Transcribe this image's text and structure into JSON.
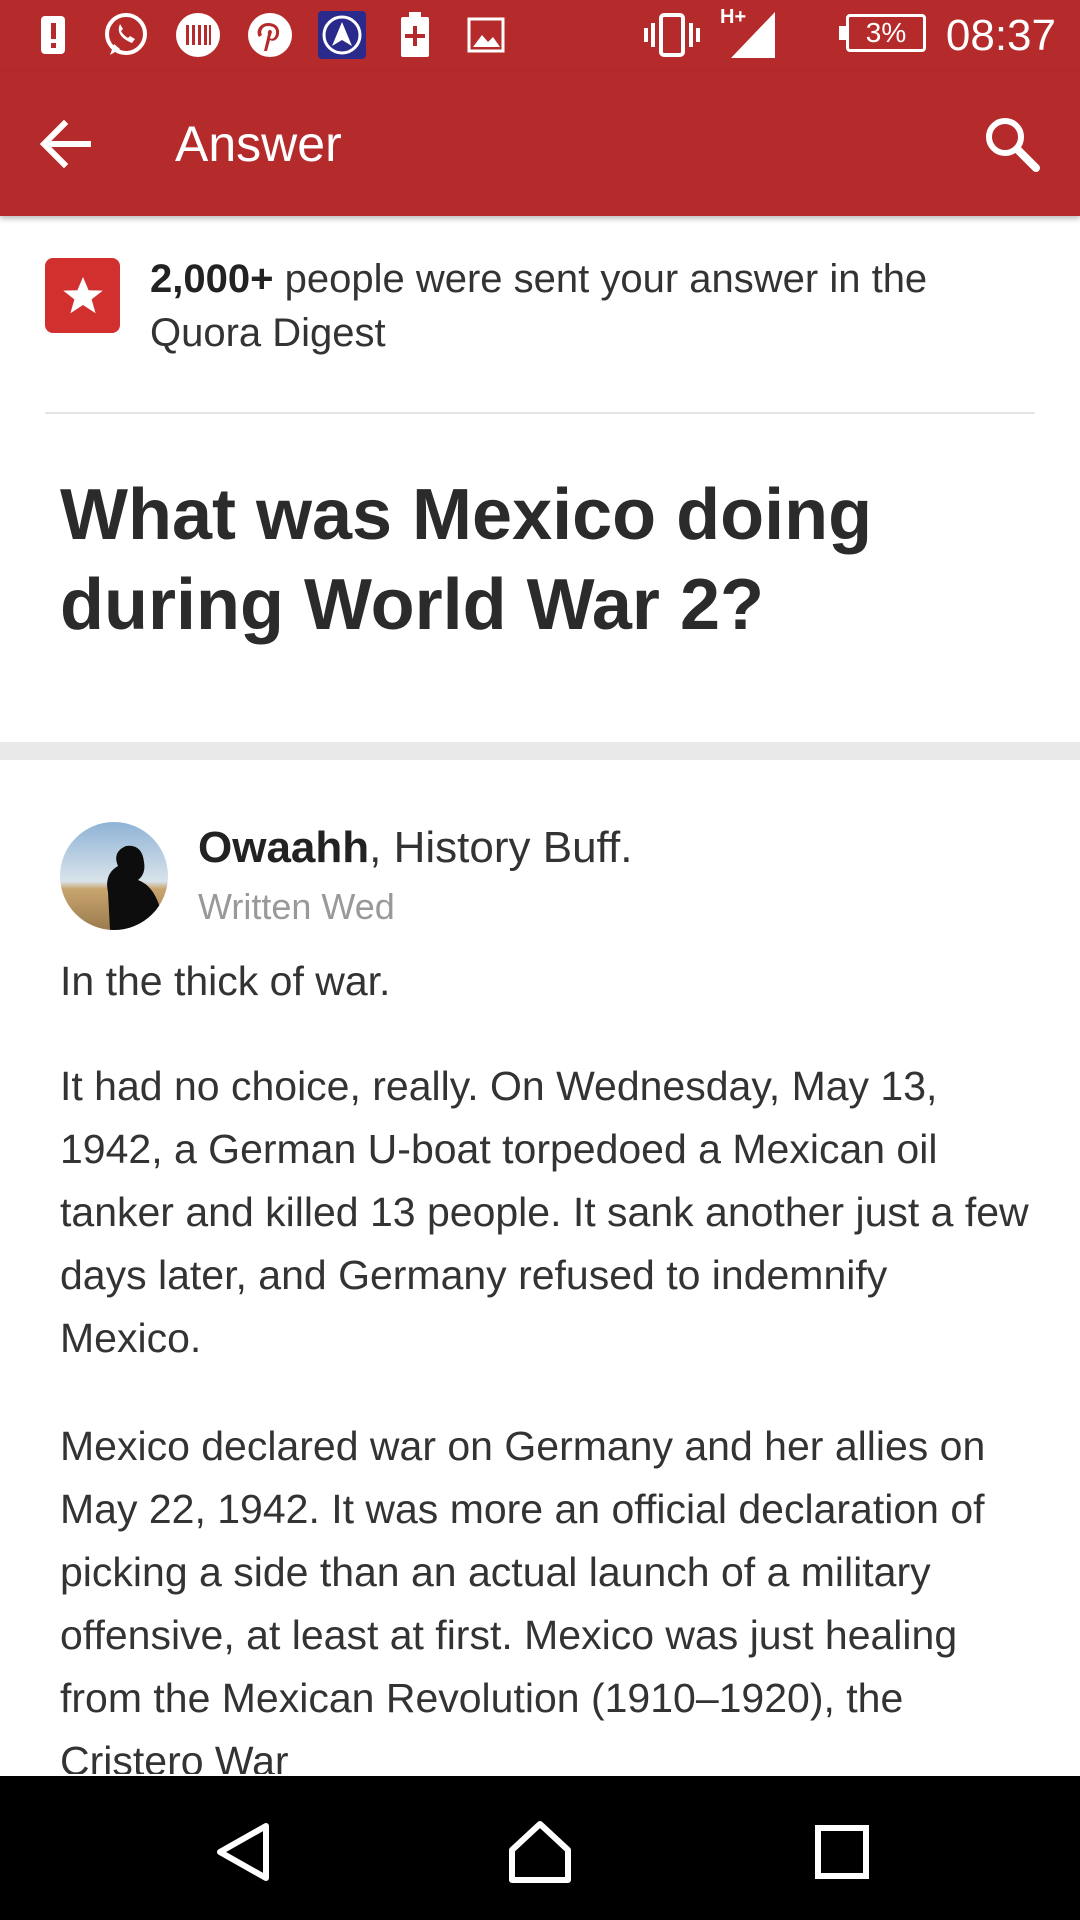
{
  "status_bar": {
    "time": "08:37",
    "battery": "3%",
    "network": "H+",
    "icons": [
      "alert-icon",
      "whatsapp-icon",
      "barcode-icon",
      "pinterest-icon",
      "app-a-icon",
      "battery-plus-icon",
      "image-icon",
      "vibrate-icon",
      "signal-icon"
    ]
  },
  "app_bar": {
    "title": "Answer",
    "back_icon": "arrow-left-icon",
    "search_icon": "search-icon"
  },
  "digest": {
    "count": "2,000+",
    "message": " people were sent your answer in the Quora Digest"
  },
  "question": {
    "title": "What was Mexico doing during World War 2?"
  },
  "answer": {
    "author_name": "Owaahh",
    "author_credential": ", History Buff.",
    "written": "Written Wed",
    "paragraphs": [
      "In the thick of war.",
      "It had no choice, really. On Wednesday, May 13, 1942, a German U-boat torpedoed a Mexican oil tanker and killed 13 people. It sank another just a few days later, and Germany refused to indemnify Mexico.",
      "Mexico declared war on Germany and her allies on May 22, 1942. It was more an official declaration of picking a side than an actual launch of a military offensive, at least at first. Mexico was just healing from the Mexican Revolution (1910–1920), the Cristero War"
    ]
  },
  "colors": {
    "brand": "#b52b2b",
    "digest_star": "#d22f2f",
    "text": "#333333",
    "muted": "#999999"
  },
  "nav_bar": {
    "icons": [
      "back-triangle-icon",
      "home-icon",
      "recents-icon"
    ]
  }
}
